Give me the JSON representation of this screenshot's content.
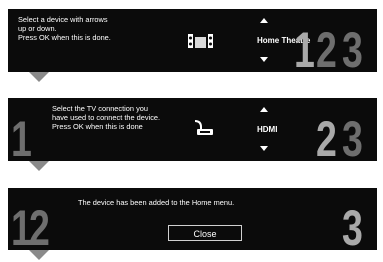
{
  "step1": {
    "instruction_lines": [
      "Select a device with arrows",
      "up or down.",
      "Press OK when this is done."
    ],
    "selected_value": "Home Theatre",
    "step_numbers": [
      "1",
      "2",
      "3"
    ],
    "icon": "home-theatre-speakers-icon"
  },
  "step2": {
    "instruction_lines": [
      "Select the TV connection you",
      "have used to connect the device.",
      "Press OK when this is done"
    ],
    "selected_value": "HDMI",
    "step_numbers": [
      "1",
      "2",
      "3"
    ],
    "icon": "hdmi-cable-icon"
  },
  "step3": {
    "message": "The device has been added to the Home menu.",
    "close_label": "Close",
    "step_numbers": [
      "1",
      "2",
      "3"
    ]
  },
  "colors": {
    "panel_background": "#0b0b0b",
    "inactive_step_number": "#6e6e6e",
    "active_step_number": "#a9a9a9",
    "pointer": "#8a8a8a"
  }
}
